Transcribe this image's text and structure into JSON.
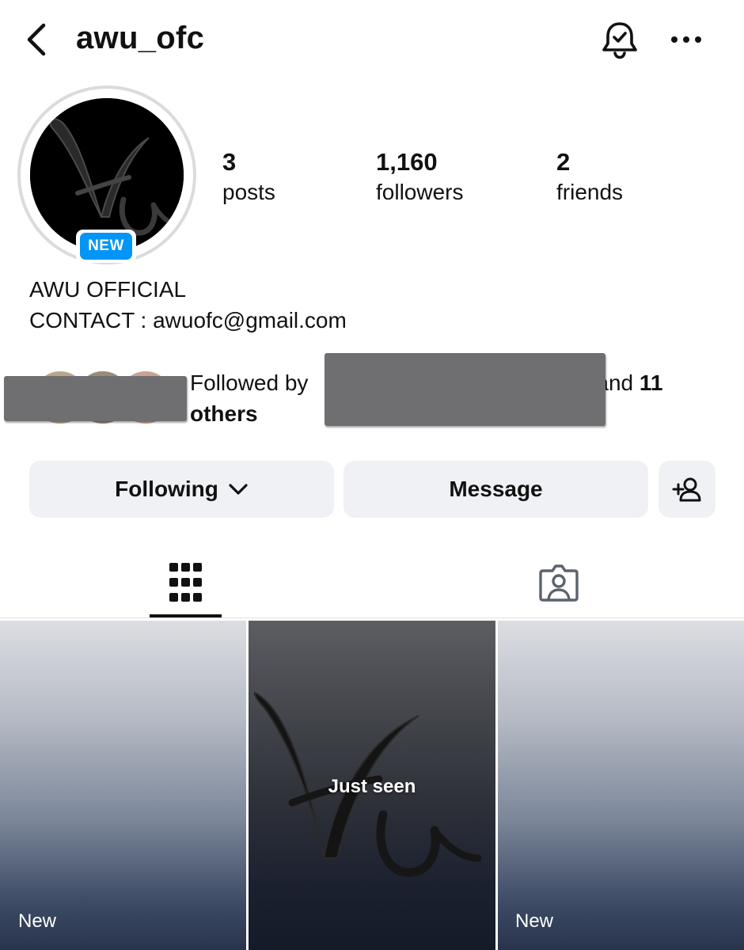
{
  "header": {
    "username": "awu_ofc",
    "back_icon": "chevron-left-icon",
    "notification_icon": "bell-check-icon",
    "more_icon": "more-horizontal-icon"
  },
  "profile": {
    "avatar_badge": "NEW",
    "stats": {
      "posts_count": "3",
      "posts_label": "posts",
      "followers_count": "1,160",
      "followers_label": "followers",
      "friends_count": "2",
      "friends_label": "friends"
    },
    "bio": {
      "name": "AWU OFFICIAL",
      "contact": "CONTACT : awuofc@gmail.com"
    },
    "followed_by": {
      "prefix": "Followed by",
      "middle": "and",
      "count_phrase": "11 others"
    }
  },
  "actions": {
    "following_label": "Following",
    "message_label": "Message",
    "add_friend_icon": "add-person-icon"
  },
  "tabs": [
    {
      "name": "posts-grid",
      "icon": "grid-icon",
      "active": true
    },
    {
      "name": "tagged",
      "icon": "tagged-person-icon",
      "active": false
    }
  ],
  "grid": {
    "tiles": [
      {
        "label": "New"
      },
      {
        "label": "Just seen"
      },
      {
        "label": "New"
      }
    ]
  },
  "colors": {
    "badge_blue": "#0095f6",
    "button_bg": "#eff1f4",
    "redaction_gray": "#6f6f72"
  }
}
